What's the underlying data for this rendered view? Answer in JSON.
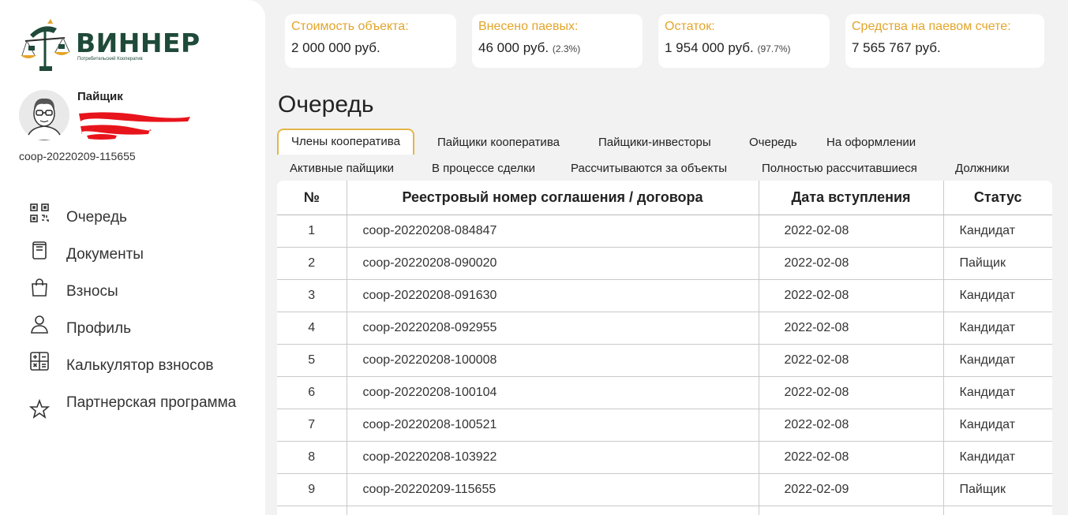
{
  "brand": {
    "name": "ВИННЕР",
    "subtitle": "Потребительский Кооператив"
  },
  "user": {
    "role": "Пайщик",
    "id": "coop-20220209-115655"
  },
  "menu": [
    {
      "label": "Очередь",
      "icon": "qr-icon"
    },
    {
      "label": "Документы",
      "icon": "document-icon"
    },
    {
      "label": "Взносы",
      "icon": "bag-icon"
    },
    {
      "label": "Профиль",
      "icon": "user-icon"
    },
    {
      "label": "Калькулятор взносов",
      "icon": "calculator-icon"
    },
    {
      "label": "Партнерская программа",
      "icon": "star-icon"
    }
  ],
  "cards": [
    {
      "caption": "Стоимость объекта:",
      "value": "2 000 000 руб.",
      "pct": ""
    },
    {
      "caption": "Внесено паевых:",
      "value": "46 000 руб.",
      "pct": "(2.3%)"
    },
    {
      "caption": "Остаток:",
      "value": "1 954 000 руб.",
      "pct": "(97.7%)"
    },
    {
      "caption": "Средства на паевом счете:",
      "value": "7 565 767 руб.",
      "pct": ""
    }
  ],
  "page_title": "Очередь",
  "tabs": [
    "Члены кооператива",
    "Пайщики кооператива",
    "Пайщики-инвесторы",
    "Очередь",
    "На оформлении",
    "Активные пайщики",
    "В процессе сделки",
    "Рассчитываются за объекты",
    "Полностью рассчитавшиеся",
    "Должники"
  ],
  "active_tab": "Члены кооператива",
  "table": {
    "headers": [
      "№",
      "Реестровый номер соглашения / договора",
      "Дата вступления",
      "Статус"
    ],
    "rows": [
      [
        "1",
        "coop-20220208-084847",
        "2022-02-08",
        "Кандидат"
      ],
      [
        "2",
        "coop-20220208-090020",
        "2022-02-08",
        "Пайщик"
      ],
      [
        "3",
        "coop-20220208-091630",
        "2022-02-08",
        "Кандидат"
      ],
      [
        "4",
        "coop-20220208-092955",
        "2022-02-08",
        "Кандидат"
      ],
      [
        "5",
        "coop-20220208-100008",
        "2022-02-08",
        "Кандидат"
      ],
      [
        "6",
        "coop-20220208-100104",
        "2022-02-08",
        "Кандидат"
      ],
      [
        "7",
        "coop-20220208-100521",
        "2022-02-08",
        "Кандидат"
      ],
      [
        "8",
        "coop-20220208-103922",
        "2022-02-08",
        "Кандидат"
      ],
      [
        "9",
        "coop-20220209-115655",
        "2022-02-09",
        "Пайщик"
      ]
    ]
  },
  "colors": {
    "accent": "#e3a52a",
    "brand": "#1f4a3a",
    "redaction": "#e8141c"
  }
}
